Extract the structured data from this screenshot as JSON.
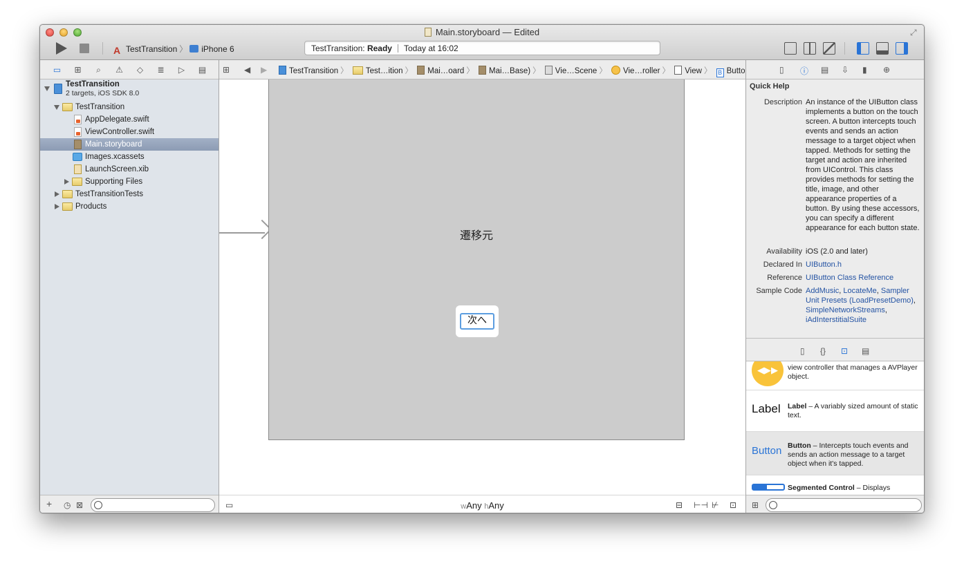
{
  "window": {
    "title": "Main.storyboard — Edited"
  },
  "toolbar": {
    "run_icon": "play-icon",
    "stop_icon": "stop-icon",
    "scheme": "TestTransition",
    "device": "iPhone 6",
    "activity": {
      "project": "TestTransition:",
      "status": "Ready",
      "time": "Today at 16:02"
    }
  },
  "navigator": {
    "tabs": [
      "folder-icon",
      "hierarchy-icon",
      "search-icon",
      "warning-icon",
      "test-icon",
      "debug-icon",
      "breakpoint-icon",
      "log-icon"
    ],
    "project": {
      "name": "TestTransition",
      "subtitle": "2 targets, iOS SDK 8.0"
    },
    "items": [
      {
        "label": "TestTransition",
        "type": "folder"
      },
      {
        "label": "AppDelegate.swift",
        "type": "swift"
      },
      {
        "label": "ViewController.swift",
        "type": "swift"
      },
      {
        "label": "Main.storyboard",
        "type": "storyboard"
      },
      {
        "label": "Images.xcassets",
        "type": "assets"
      },
      {
        "label": "LaunchScreen.xib",
        "type": "xib"
      },
      {
        "label": "Supporting Files",
        "type": "folder"
      },
      {
        "label": "TestTransitionTests",
        "type": "folder"
      },
      {
        "label": "Products",
        "type": "folder"
      }
    ],
    "add_label": "+"
  },
  "jumpbar": {
    "crumbs": [
      "TestTransition",
      "Test…ition",
      "Mai…oard",
      "Mai…Base)",
      "Vie…Scene",
      "Vie…roller",
      "View",
      "Button"
    ]
  },
  "canvas": {
    "scene_label": "遷移元",
    "button_title": "次へ"
  },
  "editor_bottom": {
    "w_prefix": "w",
    "w_value": "Any",
    "h_prefix": "h",
    "h_value": "Any"
  },
  "quick_help": {
    "title": "Quick Help",
    "description_key": "Description",
    "description": "An instance of the UIButton class implements a button on the touch screen. A button intercepts touch events and sends an action message to a target object when tapped. Methods for setting the target and action are inherited from UIControl. This class provides methods for setting the title, image, and other appearance properties of a button. By using these accessors, you can specify a different appearance for each button state.",
    "availability_key": "Availability",
    "availability": "iOS (2.0 and later)",
    "declared_key": "Declared In",
    "declared": "UIButton.h",
    "reference_key": "Reference",
    "reference": "UIButton Class Reference",
    "sample_key": "Sample Code",
    "samples": [
      "AddMusic",
      "LocateMe",
      "Sampler Unit Presets (LoadPresetDemo)",
      "SimpleNetworkStreams",
      "iAdInterstitialSuite"
    ]
  },
  "library": {
    "items": [
      {
        "thumb": "◀▶▶",
        "name": "",
        "desc": "view controller that manages a AVPlayer object."
      },
      {
        "thumb": "Label",
        "name": "Label",
        "desc": " – A variably sized amount of static text."
      },
      {
        "thumb": "Button",
        "name": "Button",
        "desc": " – Intercepts touch events and sends an action message to a target object when it's tapped."
      },
      {
        "thumb": "",
        "name": "Segmented Control",
        "desc": " – Displays"
      }
    ]
  },
  "colors": {
    "accent": "#2a74d6",
    "selection": "#8c9bb4",
    "link": "#2453a3"
  }
}
